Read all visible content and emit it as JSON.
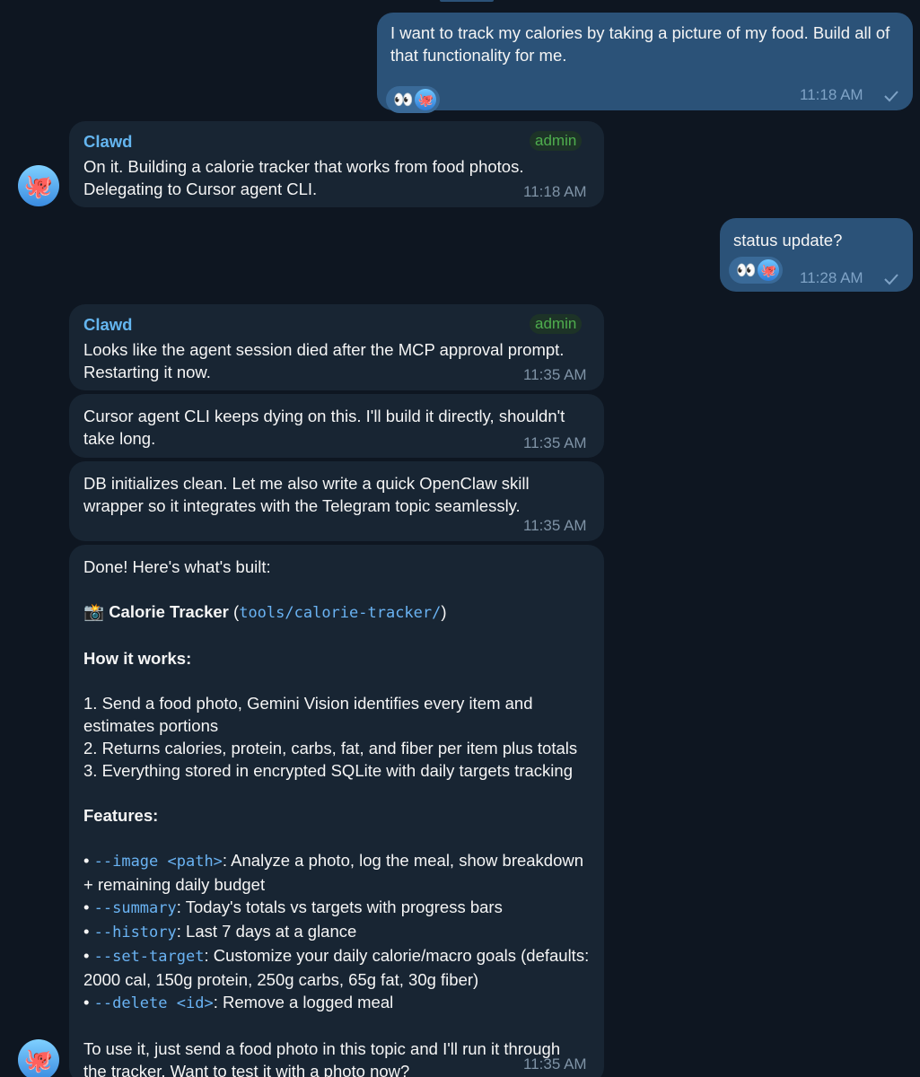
{
  "messages": [
    {
      "id": "m1",
      "text": "I want to track my calories by taking a picture of my food. Build all of that functionality for me.",
      "time": "11:18 AM",
      "reactions": [
        "👀",
        "🐙"
      ]
    },
    {
      "id": "m2",
      "sender": "Clawd",
      "role": "admin",
      "text": "On it. Building a calorie tracker that works from food photos. Delegating to Cursor agent CLI.",
      "time": "11:18 AM"
    },
    {
      "id": "m3",
      "text": "status update?",
      "time": "11:28 AM",
      "reactions": [
        "👀",
        "🐙"
      ]
    },
    {
      "id": "m4",
      "sender": "Clawd",
      "role": "admin",
      "text": "Looks like the agent session died after the MCP approval prompt. Restarting it now.",
      "time": "11:35 AM"
    },
    {
      "id": "m5",
      "text": "Cursor agent CLI keeps dying on this. I'll build it directly, shouldn't take long.",
      "time": "11:35 AM"
    },
    {
      "id": "m6",
      "text": "DB initializes clean. Let me also write a quick OpenClaw skill wrapper so it integrates with the Telegram topic seamlessly.",
      "time": "11:35 AM"
    },
    {
      "id": "m7",
      "time": "11:35 AM",
      "intro": "Done! Here's what's built:",
      "title_emoji": "📸",
      "title": "Calorie Tracker",
      "title_paren_open": " (",
      "title_path": "tools/calorie-tracker/",
      "title_paren_close": ")",
      "how_heading": "How it works:",
      "steps": [
        "1. Send a food photo, Gemini Vision identifies every item and estimates portions",
        "2. Returns calories, protein, carbs, fat, and fiber per item plus totals",
        "3. Everything stored in encrypted SQLite with daily targets tracking"
      ],
      "features_heading": "Features:",
      "features": [
        {
          "bullet": "• ",
          "flag": "--image <path>",
          "desc": ": Analyze a photo, log the meal, show breakdown + remaining daily budget"
        },
        {
          "bullet": "• ",
          "flag": "--summary",
          "desc": ": Today's totals vs targets with progress bars"
        },
        {
          "bullet": "• ",
          "flag": "--history",
          "desc": ": Last 7 days at a glance"
        },
        {
          "bullet": "• ",
          "flag": "--set-target",
          "desc": ": Customize your daily calorie/macro goals (defaults: 2000 cal, 150g protein, 250g carbs, 65g fat, 30g fiber)"
        },
        {
          "bullet": "• ",
          "flag": "--delete <id>",
          "desc": ": Remove a logged meal"
        }
      ],
      "outro": "To use it, just send a food photo in this topic and I'll run it through the tracker. Want to test it with a photo now?"
    }
  ],
  "avatar_icon": "octopus-icon",
  "colors": {
    "outgoing": "#2b5278",
    "incoming": "#182533",
    "background": "#0e1621",
    "sender": "#64b5ef",
    "admin": "#4fae4e",
    "code": "#6ab3f3"
  }
}
